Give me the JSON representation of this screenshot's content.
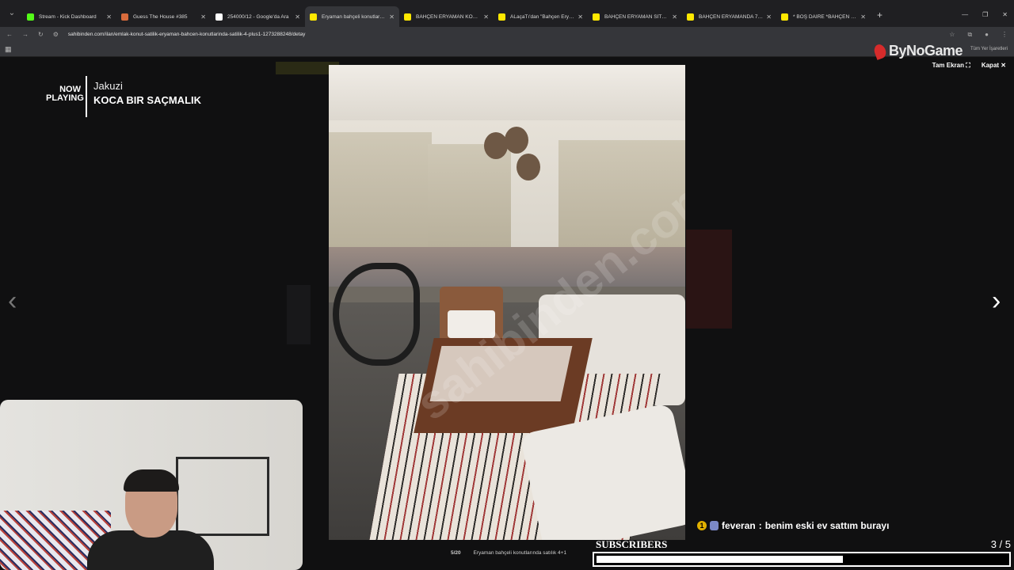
{
  "browser": {
    "tabs": [
      {
        "title": "Stream - Kick Dashboard",
        "favicon_color": "#53fc18"
      },
      {
        "title": "Guess The House #385",
        "favicon_color": "#d86b3c"
      },
      {
        "title": "254000/12 - Google'da Ara",
        "favicon_color": "#ffffff"
      },
      {
        "title": "Eryaman bahçeli konutlarında",
        "favicon_color": "#ffe800",
        "active": true
      },
      {
        "title": "BAHÇEN ERYAMAN KONUTLAR",
        "favicon_color": "#ffe800"
      },
      {
        "title": "ALaçaTı'dan \"Bahçen Eryaman",
        "favicon_color": "#ffe800"
      },
      {
        "title": "BAHÇEN ERYAMAN SİTESİNDE",
        "favicon_color": "#ffe800"
      },
      {
        "title": "BAHÇEN ERYAMANDA 7/24 GÜ",
        "favicon_color": "#ffe800"
      },
      {
        "title": "* BOŞ DAİRE *BAHÇEN ERYAM",
        "favicon_color": "#ffe800"
      }
    ],
    "url": "sahibinden.com/ilan/emlak-konut-satilik-eryaman-bahcen-konutlarinda-satilik-4-plus1-1273288248/detay",
    "bookmarks_all_label": "Tüm Yer İşaretleri"
  },
  "lightbox": {
    "fullscreen_label": "Tam Ekran",
    "close_label": "Kapat",
    "counter": "5/20",
    "caption": "Eryaman bahçeli konutlarında satılık 4+1",
    "watermark": "sahibinden.com"
  },
  "overlay": {
    "now_playing_label": "NOW PLAYING",
    "artist": "Jakuzi",
    "song": "KOCA BIR SAÇMALIK",
    "logo": "ByNoGame",
    "chat": {
      "user": "feveran",
      "message": "benim eski ev sattım burayı"
    },
    "subscribers": {
      "label": "SUBSCRIBERS",
      "count": "3 / 5",
      "progress": 0.6
    }
  }
}
